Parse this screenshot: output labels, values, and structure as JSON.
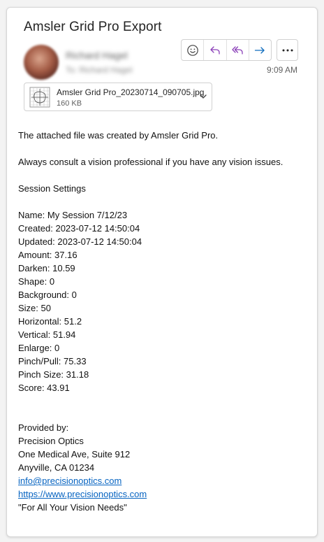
{
  "message": {
    "subject": "Amsler Grid Pro Export",
    "sender_name": "Richard Hagel",
    "recipient": "To: Richard Hagel",
    "time": "9:09 AM"
  },
  "actions": {
    "icons": [
      "emoji-icon",
      "reply-icon",
      "reply-all-icon",
      "forward-icon",
      "more-icon"
    ]
  },
  "attachment": {
    "filename": "Amsler Grid Pro_20230714_090705.jpg",
    "size": "160 KB"
  },
  "body": {
    "intro": "The attached file was created by Amsler Grid Pro.",
    "advice": "Always consult a vision professional if you have any vision issues.",
    "settings_heading": "Session Settings",
    "settings": [
      "Name: My Session 7/12/23",
      "Created: 2023-07-12 14:50:04",
      "Updated: 2023-07-12 14:50:04",
      "Amount: 37.16",
      "Darken: 10.59",
      "Shape: 0",
      "Background: 0",
      "Size: 50",
      "Horizontal: 51.2",
      "Vertical: 51.94",
      "Enlarge: 0",
      "Pinch/Pull: 75.33",
      "Pinch Size: 31.18",
      "Score: 43.91"
    ],
    "provided_by": "Provided by:",
    "company": "Precision Optics",
    "address1": "One Medical Ave, Suite 912",
    "address2": "Anyville, CA 01234",
    "email": "info@precisionoptics.com",
    "website": "https://www.precisionoptics.com",
    "tagline": "\"For All Your Vision Needs\""
  },
  "colors": {
    "accent_purple": "#8a3fb8",
    "forward_blue": "#0f6cbd",
    "link": "#0563c1"
  }
}
